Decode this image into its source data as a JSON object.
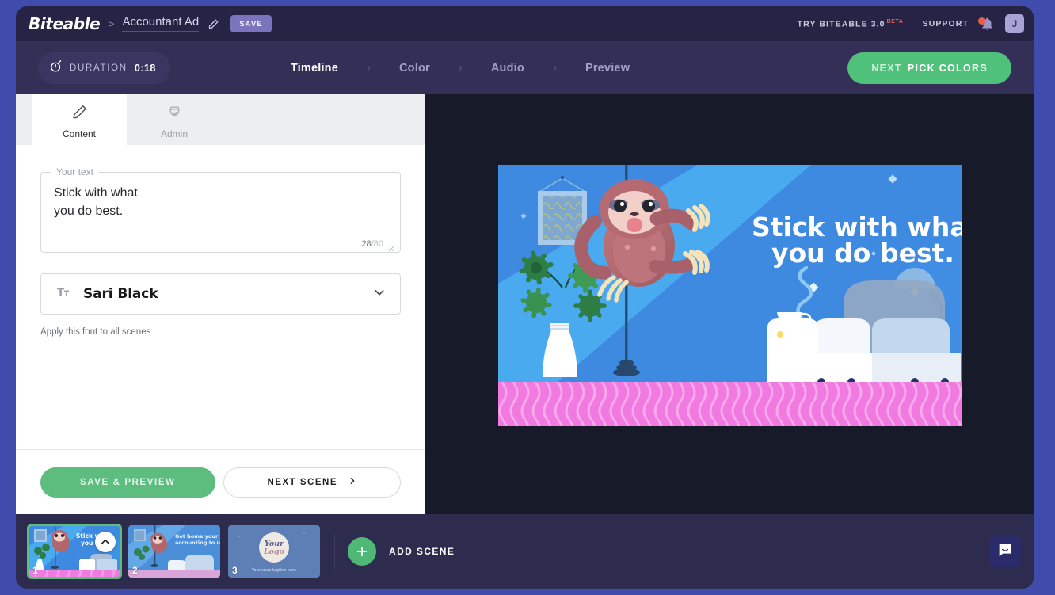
{
  "header": {
    "brand": "Biteable",
    "breadcrumb_separator": ">",
    "project_name": "Accountant Ad",
    "edit_icon": "pencil-icon",
    "save_label": "SAVE",
    "try_label": "TRY BITEABLE 3.0",
    "beta_label": "BETA",
    "support_label": "SUPPORT",
    "notification_icon": "bell-icon",
    "has_notification": true,
    "avatar_initial": "J"
  },
  "navbar": {
    "duration_icon": "stopwatch-icon",
    "duration_label": "DURATION",
    "duration_value": "0:18",
    "steps": [
      {
        "label": "Timeline",
        "active": true
      },
      {
        "label": "Color",
        "active": false
      },
      {
        "label": "Audio",
        "active": false
      },
      {
        "label": "Preview",
        "active": false
      }
    ],
    "step_separator": "›",
    "next_prefix": "NEXT",
    "next_action": "PICK COLORS"
  },
  "panel": {
    "tabs": [
      {
        "label": "Content",
        "icon": "pencil-icon",
        "active": true
      },
      {
        "label": "Admin",
        "icon": "police-officer-icon",
        "active": false
      }
    ],
    "text_field": {
      "legend": "Your text",
      "value": "Stick with what\nyou do best.",
      "char_count": "28",
      "char_separator": "/",
      "char_max": "80"
    },
    "font_select": {
      "icon": "text-format-icon",
      "value": "Sari Black",
      "chevron": "chevron-down-icon"
    },
    "apply_font_link": "Apply this font to all scenes",
    "save_preview_label": "SAVE & PREVIEW",
    "next_scene_label": "NEXT SCENE",
    "next_scene_chevron": "›"
  },
  "preview": {
    "headline_line1": "Stick with what",
    "headline_line2": "you do best.",
    "colors": {
      "wall_dark": "#3f8ee0",
      "wall_light": "#4aaaf0",
      "floor": "#f07ae0",
      "sloth_body": "#b0666b",
      "sofa": "#ffffff"
    }
  },
  "scene_strip": {
    "scenes": [
      {
        "number": "1",
        "selected": true,
        "caption_line1": "Stick with what",
        "caption_line2": "you do best."
      },
      {
        "number": "2",
        "selected": false,
        "caption_line1": "Get home your",
        "caption_line2": "accounting to us."
      },
      {
        "number": "3",
        "selected": false,
        "logo_line1": "Your",
        "logo_line2": "Logo",
        "tagline": "Your snap tagline here"
      }
    ],
    "collapse_icon": "chevron-up-icon",
    "add_scene_icon": "plus-icon",
    "add_scene_label": "ADD SCENE",
    "chat_icon": "chat-bubble-icon"
  }
}
